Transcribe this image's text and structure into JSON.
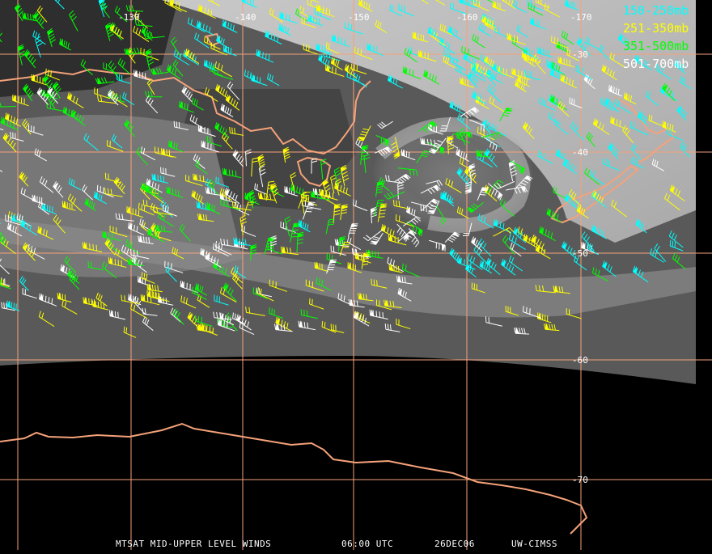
{
  "map": {
    "lon_labels": [
      "-130",
      "-140",
      "-150",
      "-160",
      "-170"
    ],
    "lat_labels": [
      "-30",
      "-40",
      "-50",
      "-60",
      "-70"
    ]
  },
  "legend": [
    {
      "label": "150-250mb",
      "color": "#00ffff"
    },
    {
      "label": "251-350mb",
      "color": "#ffff00"
    },
    {
      "label": "351-500mb",
      "color": "#00ff00"
    },
    {
      "label": "501-700mb",
      "color": "#ffffff"
    }
  ],
  "footer": {
    "product": "MTSAT MID-UPPER LEVEL WINDS",
    "time": "06:00 UTC",
    "date": "26DEC06",
    "source": "UW-CIMSS"
  },
  "colors": {
    "grid": "#f4a27a",
    "coast": "#f4a27a",
    "background": "#000000"
  }
}
